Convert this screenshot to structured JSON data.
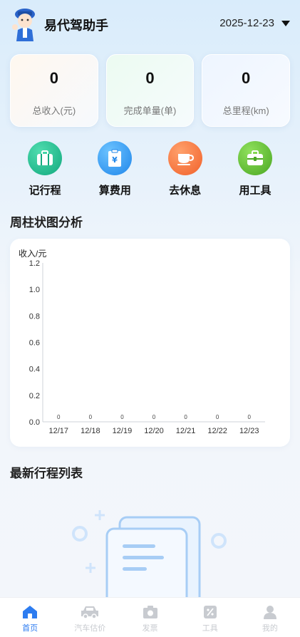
{
  "header": {
    "title": "易代驾助手",
    "date": "2025-12-23"
  },
  "stats": [
    {
      "value": "0",
      "label": "总收入(元)"
    },
    {
      "value": "0",
      "label": "完成单量(单)"
    },
    {
      "value": "0",
      "label": "总里程(km)"
    }
  ],
  "quick_actions": [
    {
      "label": "记行程",
      "icon": "briefcase-icon",
      "color": "#1fbf93"
    },
    {
      "label": "算费用",
      "icon": "receipt-yen-icon",
      "color": "#3aa0f6"
    },
    {
      "label": "去休息",
      "icon": "coffee-cup-icon",
      "color": "#fb7b3f"
    },
    {
      "label": "用工具",
      "icon": "toolbox-icon",
      "color": "#66c431"
    }
  ],
  "sections": {
    "chart_title": "周柱状图分析",
    "trips_title": "最新行程列表"
  },
  "chart_data": {
    "type": "bar",
    "ylabel": "收入/元",
    "categories": [
      "12/17",
      "12/18",
      "12/19",
      "12/20",
      "12/21",
      "12/22",
      "12/23"
    ],
    "values": [
      0,
      0,
      0,
      0,
      0,
      0,
      0
    ],
    "data_labels": [
      "0",
      "0",
      "0",
      "0",
      "0",
      "0",
      "0"
    ],
    "yticks": [
      "0.0",
      "0.2",
      "0.4",
      "0.6",
      "0.8",
      "1.0",
      "1.2"
    ],
    "ylim": [
      0,
      1.2
    ],
    "grid": false
  },
  "tabbar": [
    {
      "label": "首页",
      "icon": "home-icon",
      "active": true
    },
    {
      "label": "汽车估价",
      "icon": "car-icon",
      "active": false
    },
    {
      "label": "发票",
      "icon": "camera-icon",
      "active": false
    },
    {
      "label": "工具",
      "icon": "percent-tool-icon",
      "active": false
    },
    {
      "label": "我的",
      "icon": "user-icon",
      "active": false
    }
  ],
  "colors": {
    "accent": "#2d7cf0",
    "inactive": "#c8cbd0"
  }
}
